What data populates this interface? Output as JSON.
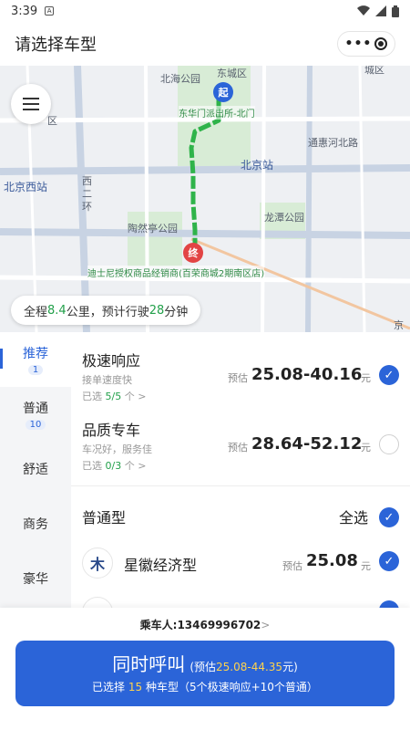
{
  "status": {
    "time": "3:39",
    "notif": "A"
  },
  "header": {
    "title": "请选择车型"
  },
  "map": {
    "labels": {
      "beihai": "北海公园",
      "dongcheng": "东城区",
      "dongcheng_frag": "城区",
      "dongcheng_left": "区",
      "donghua": "东华门派出所-北门",
      "tonghuihe": "通惠河北路",
      "beijing_station": "北京站",
      "beijing_west": "北京西站",
      "west_ring": "西二环",
      "taoranting": "陶然亭公园",
      "longtan": "龙潭公园",
      "disney": "迪士尼授权商品经销商(百荣商城2期南区店)",
      "jing": "京"
    },
    "start_pin": "起",
    "end_pin": "终",
    "summary": {
      "prefix": "全程",
      "distance": "8.4",
      "mid": "公里，预计行驶",
      "minutes": "28",
      "suffix": "分钟"
    }
  },
  "tabs": [
    {
      "label": "推荐",
      "badge": "1"
    },
    {
      "label": "普通",
      "badge": "10"
    },
    {
      "label": "舒适",
      "badge": ""
    },
    {
      "label": "商务",
      "badge": ""
    },
    {
      "label": "豪华",
      "badge": ""
    }
  ],
  "options": [
    {
      "name": "极速响应",
      "sub": "接单速度快",
      "sel_prefix": "已选 ",
      "sel_count": "5/5",
      "sel_suffix": " 个 >",
      "est": "预估",
      "price": "25.08-40.16",
      "unit": "元",
      "checked": true
    },
    {
      "name": "品质专车",
      "sub": "车况好，服务佳",
      "sel_prefix": "已选 ",
      "sel_count": "0/3",
      "sel_suffix": " 个 >",
      "est": "预估",
      "price": "28.64-52.12",
      "unit": "元",
      "checked": false
    }
  ],
  "group": {
    "title": "普通型",
    "select_all": "全选",
    "items": [
      {
        "name": "星徽经济型",
        "est": "预估",
        "price": "25.08",
        "unit": "元",
        "checked": true
      }
    ]
  },
  "bottom": {
    "passenger": "乘车人:13469996702",
    "chevron": ">",
    "call_main": "同时呼叫",
    "est_open": "(预估",
    "est_range": "25.08-44.35",
    "est_close": "元)",
    "sel_prefix": "已选择 ",
    "sel_count": "15",
    "sel_suffix": " 种车型（5个极速响应+10个普通）"
  },
  "colors": {
    "accent": "#2b64d8",
    "green": "#22a04a",
    "route": "#2fb34a",
    "end_pin": "#e24444"
  }
}
